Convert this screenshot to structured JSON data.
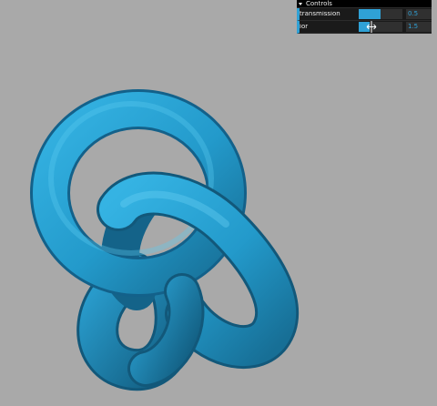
{
  "gui": {
    "folder_title": "Controls",
    "accent_color": "#2fa1d6",
    "controllers": [
      {
        "label": "transmission",
        "value": "0.5",
        "fill": 0.5
      },
      {
        "label": "ior",
        "value": "1.5",
        "fill": 0.25
      }
    ]
  },
  "scene": {
    "background_color": "#a9a9a9",
    "object": "torus-knot",
    "object_color": "#2a9fd0"
  }
}
